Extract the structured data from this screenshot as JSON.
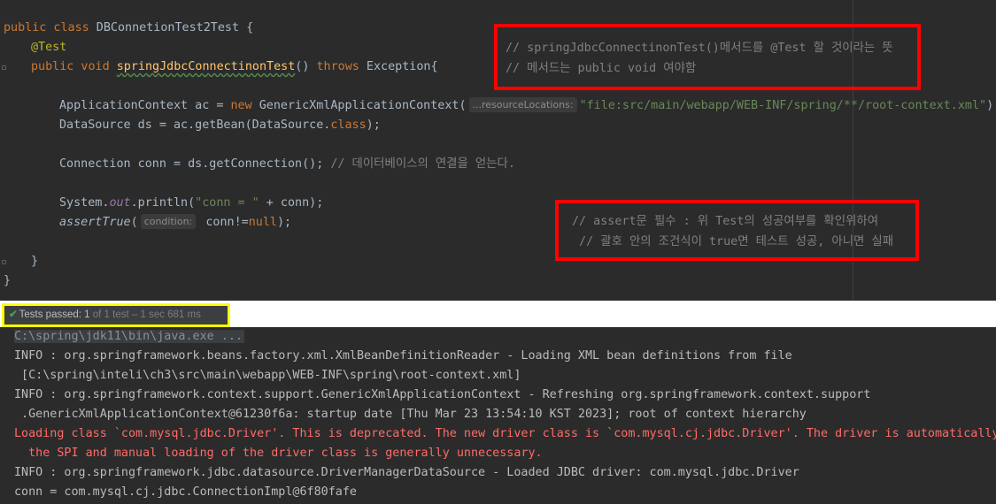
{
  "code": {
    "l1": {
      "kw": "public class",
      "name": " DBConnetionTest2Test {"
    },
    "l2": "@Test",
    "l3": {
      "kw": "public void ",
      "fn": "springJdbcConnectinonTest",
      "mid": "() ",
      "kw2": "throws",
      "rest": " Exception{"
    },
    "l4": {
      "a": "ApplicationContext ac = ",
      "kw": "new",
      "b": " GenericXmlApplicationContext(",
      "hint": "...resourceLocations:",
      "str": "\"file:src/main/webapp/WEB-INF/spring/**/root-context.xml\"",
      "end": ");"
    },
    "l5": {
      "a": "DataSource ds = ac.getBean(DataSource.",
      "kw": "class",
      "end": ");"
    },
    "l6": {
      "a": "Connection conn = ds.getConnection(); ",
      "cmt": "// 데이터베이스의 연결을 얻는다."
    },
    "l7": {
      "a": "System.",
      "static": "out",
      "b": ".println(",
      "str": "\"conn = \"",
      "c": " + conn);"
    },
    "l8": {
      "fn": "assertTrue",
      "a": "(",
      "hint": "condition:",
      "b": " conn!=",
      "kw": "null",
      "end": ");"
    },
    "l9": "}",
    "l10": "}"
  },
  "annotations": {
    "box1_line1": "// springJdbcConnectinonTest()메서드를 @Test 할 것이라는 뜻",
    "box1_line2": "// 메서드는 public void 여야함",
    "box2_line1": "// assert문 필수 : 위 Test의 성공여부를 확인위하여",
    "box2_line2": " // 괄호 안의 조건식이 true면 테스트 성공, 아니면 실패"
  },
  "test_bar": {
    "check": "✔",
    "status": "Tests passed: 1",
    "detail": " of 1 test – 1 sec 681 ms"
  },
  "console": {
    "cmd": "C:\\spring\\jdk11\\bin\\java.exe ...",
    "lines": [
      "INFO : org.springframework.beans.factory.xml.XmlBeanDefinitionReader - Loading XML bean definitions from file",
      " [C:\\spring\\inteli\\ch3\\src\\main\\webapp\\WEB-INF\\spring\\root-context.xml]",
      "INFO : org.springframework.context.support.GenericXmlApplicationContext - Refreshing org.springframework.context.support",
      " .GenericXmlApplicationContext@61230f6a: startup date [Thu Mar 23 13:54:10 KST 2023]; root of context hierarchy",
      "Loading class `com.mysql.jdbc.Driver'. This is deprecated. The new driver class is `com.mysql.cj.jdbc.Driver'. The driver is automatically",
      "  the SPI and manual loading of the driver class is generally unnecessary.",
      "INFO : org.springframework.jdbc.datasource.DriverManagerDataSource - Loaded JDBC driver: com.mysql.jdbc.Driver",
      "conn = com.mysql.cj.jdbc.ConnectionImpl@6f80fafe"
    ]
  },
  "colors": {
    "highlight_box": "#ff0000",
    "test_highlight": "#ffff00",
    "error_text": "#ff6b68"
  }
}
